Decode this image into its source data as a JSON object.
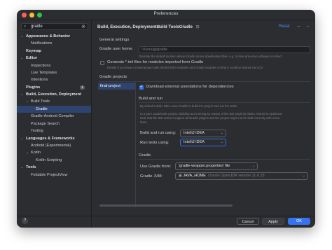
{
  "window": {
    "title": "Preferences"
  },
  "search": {
    "value": "gradle"
  },
  "sidebar": {
    "items": [
      {
        "label": "Appearance & Behavior",
        "arrow": "v"
      },
      {
        "label": "Notifications"
      },
      {
        "label": "Keymap"
      },
      {
        "label": "Editor",
        "arrow": "v"
      },
      {
        "label": "Inspections"
      },
      {
        "label": "Live Templates"
      },
      {
        "label": "Intentions"
      },
      {
        "label": "Plugins",
        "badge": "1"
      },
      {
        "label": "Build, Execution, Deployment",
        "arrow": "v"
      },
      {
        "label": "Build Tools",
        "arrow": "v"
      },
      {
        "label": "Gradle"
      },
      {
        "label": "Gradle-Android Compiler"
      },
      {
        "label": "Package Search"
      },
      {
        "label": "Testing"
      },
      {
        "label": "Languages & Frameworks",
        "arrow": "v"
      },
      {
        "label": "Android (Experimental)"
      },
      {
        "label": "Kotlin",
        "arrow": "v"
      },
      {
        "label": "Kotlin Scripting"
      },
      {
        "label": "Tools",
        "arrow": "v"
      },
      {
        "label": "Foldable ProjectView"
      }
    ]
  },
  "breadcrumb": {
    "part1": "Build, Execution, Deployment",
    "part2": "Build Tools",
    "part3": "Gradle",
    "separator": "›"
  },
  "header": {
    "reset_label": "Reset",
    "back_arrow": "←",
    "forward_arrow": "→"
  },
  "general": {
    "section_title": "General settings",
    "user_home_label": "Gradle user home:",
    "user_home_value": "/Users/jg/gradle",
    "user_home_hint": "Override the default location where Gradle stores downloaded files, e.g. to tune anti-virus software on Wind",
    "iml_label": "Generate *.iml files for modules imported from Gradle",
    "iml_hint": "Enable if you have a mixed project with IntelliJ IDEA modules and Gradle modules so that it could be shared via VCS"
  },
  "projects": {
    "section_title": "Gradle projects",
    "selected": "final-project",
    "download_label": "Download external annotations for dependencies"
  },
  "build_run": {
    "section_title": "Build and run",
    "hint1": "By default IntelliJ IDEA uses Gradle to build the project and run the tasks.",
    "hint2": "In a pure Java/Kotlin project, building and running by means of the IDE might be faster, thanks to optimizat",
    "hint3": "Note that the IDE doesn't support all Gradle plugins and the project might not be built correctly with some",
    "hint4": "them.",
    "build_label": "Build and run using:",
    "build_value": "IntelliJ IDEA",
    "tests_label": "Run tests using:",
    "tests_value": "IntelliJ IDEA"
  },
  "gradle": {
    "section_title": "Gradle",
    "use_from_label": "Use Gradle from:",
    "use_from_value": "'gradle-wrapper.properties' file",
    "jvm_label": "Gradle JVM:",
    "jvm_name": "JAVA_HOME",
    "jvm_detail": "Oracle OpenJDK version 11.0.15"
  },
  "footer": {
    "help": "?",
    "cancel": "Cancel",
    "apply": "Apply",
    "ok": "OK"
  }
}
